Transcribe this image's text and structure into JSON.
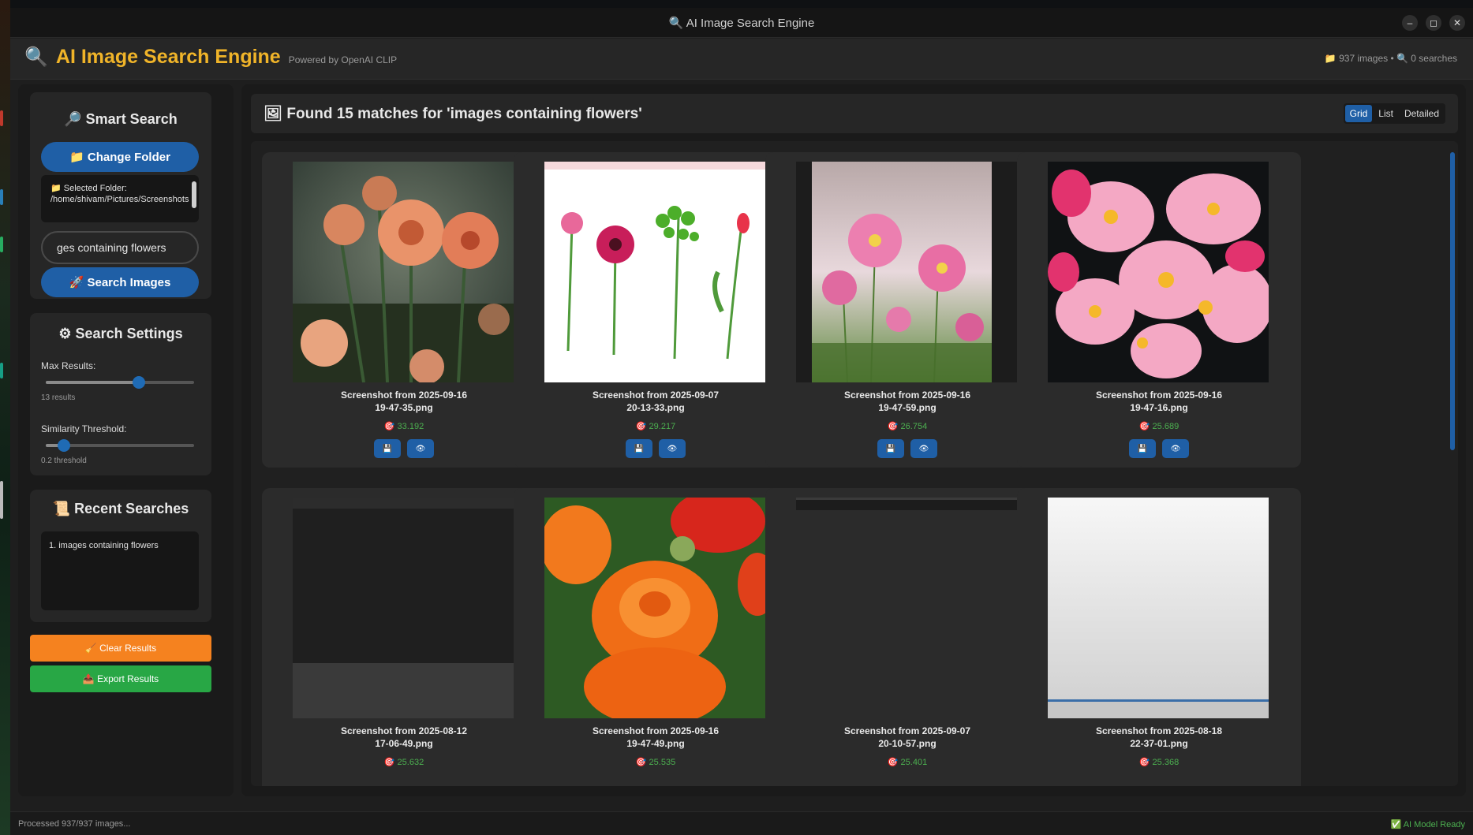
{
  "window": {
    "title": "🔍 AI Image Search Engine",
    "minimize": "–",
    "maximize": "◻",
    "close": "✕"
  },
  "header": {
    "logo_icon": "🔍",
    "title": "AI Image Search Engine",
    "subtitle": "Powered by OpenAI CLIP",
    "stats": "📁 937 images • 🔍 0 searches"
  },
  "smart_search": {
    "heading": "🔎 Smart Search",
    "change_folder": "📁 Change Folder",
    "folder_label": "📁 Selected Folder:",
    "folder_path": "/home/shivam/Pictures/Screenshots",
    "query_value": "ges containing  flowers",
    "search_button": "🚀 Search Images"
  },
  "settings": {
    "heading": "⚙ Search Settings",
    "max_results_label": "Max Results:",
    "max_results_value": "13 results",
    "max_results_fraction": 0.625,
    "threshold_label": "Similarity Threshold:",
    "threshold_value": "0.2 threshold",
    "threshold_fraction": 0.12
  },
  "recent": {
    "heading": "📜 Recent Searches",
    "items": [
      "1. images containing  flowers"
    ]
  },
  "actions": {
    "clear": "🧹 Clear Results",
    "export": "📤 Export Results",
    "clear_color": "#f5821f",
    "export_color": "#28a745"
  },
  "results": {
    "heading": "🖼 Found 15 matches for 'images containing  flowers'",
    "views": [
      "Grid",
      "List",
      "Detailed"
    ],
    "active_view": "Grid",
    "save_icon": "💾",
    "view_icon": "👁",
    "score_icon": "🎯",
    "cards": [
      {
        "name": "Screenshot from 2025-09-16\n19-47-35.png",
        "score": "33.192",
        "image": "dahlias"
      },
      {
        "name": "Screenshot from 2025-09-07\n20-13-33.png",
        "score": "29.217",
        "image": "stems"
      },
      {
        "name": "Screenshot from 2025-09-16\n19-47-59.png",
        "score": "26.754",
        "image": "cosmos"
      },
      {
        "name": "Screenshot from 2025-09-16\n19-47-16.png",
        "score": "25.689",
        "image": "begonia"
      },
      {
        "name": "Screenshot from 2025-08-12\n17-06-49.png",
        "score": "25.632",
        "image": "dark"
      },
      {
        "name": "Screenshot from 2025-09-16\n19-47-49.png",
        "score": "25.535",
        "image": "ranunculus"
      },
      {
        "name": "Screenshot from 2025-09-07\n20-10-57.png",
        "score": "25.401",
        "image": "thin"
      },
      {
        "name": "Screenshot from 2025-08-18\n22-37-01.png",
        "score": "25.368",
        "image": "white"
      }
    ]
  },
  "status": {
    "left": "Processed 937/937 images...",
    "right": "✅ AI Model Ready"
  }
}
